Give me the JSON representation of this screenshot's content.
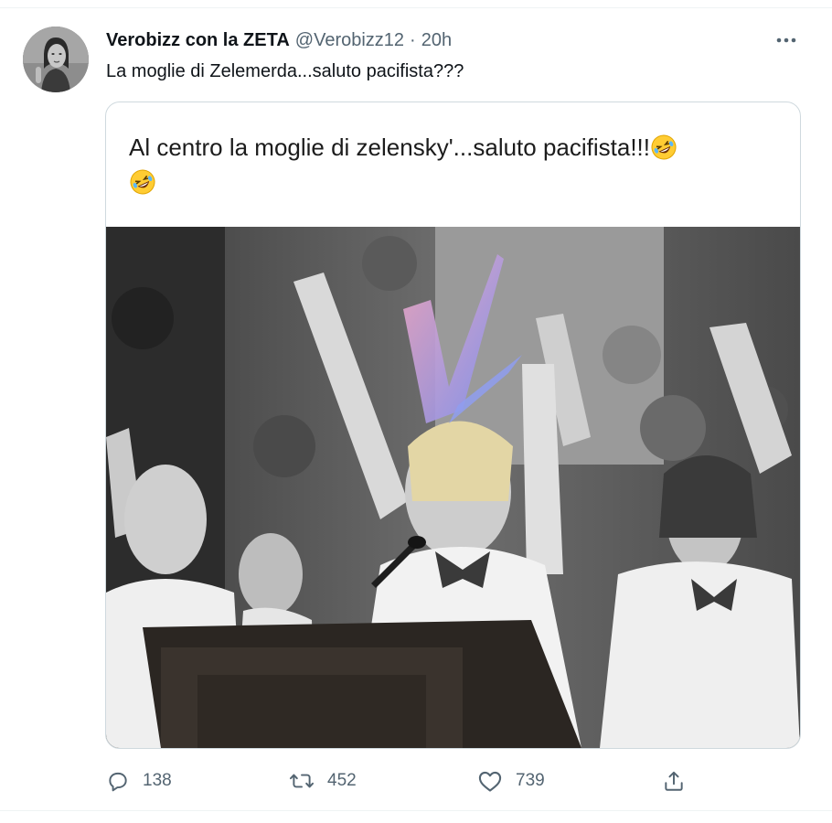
{
  "tweet": {
    "display_name": "Verobizz con la ZETA",
    "handle": "@Verobizz12",
    "separator": "·",
    "time": "20h",
    "text": "La moglie di Zelemerda...saluto pacifista???"
  },
  "media": {
    "caption": "Al centro la moglie di zelensky'...saluto pacifista!!!",
    "emoji": "rolling-on-the-floor-laughing-emoji"
  },
  "actions": {
    "reply_count": "138",
    "retweet_count": "452",
    "like_count": "739"
  },
  "icons": {
    "reply": "reply-icon",
    "retweet": "retweet-icon",
    "like": "heart-icon",
    "share": "share-icon",
    "more": "more-icon"
  },
  "colors": {
    "secondary_text": "#536471",
    "border": "#cfd9de"
  }
}
